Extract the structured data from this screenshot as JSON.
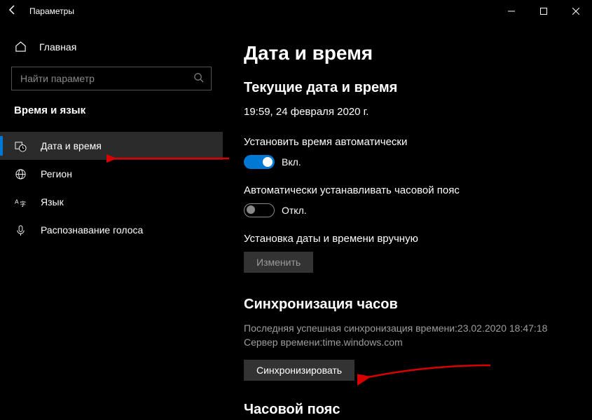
{
  "titlebar": {
    "title": "Параметры"
  },
  "sidebar": {
    "home_label": "Главная",
    "search_placeholder": "Найти параметр",
    "category_label": "Время и язык",
    "items": [
      {
        "label": "Дата и время"
      },
      {
        "label": "Регион"
      },
      {
        "label": "Язык"
      },
      {
        "label": "Распознавание голоса"
      }
    ]
  },
  "main": {
    "page_title": "Дата и время",
    "current_heading": "Текущие дата и время",
    "current_value": "19:59, 24 февраля 2020 г.",
    "auto_time_label": "Установить время автоматически",
    "auto_time_state": "Вкл.",
    "auto_tz_label": "Автоматически устанавливать часовой пояс",
    "auto_tz_state": "Откл.",
    "manual_label": "Установка даты и времени вручную",
    "change_button": "Изменить",
    "sync_heading": "Синхронизация часов",
    "sync_last": "Последняя успешная синхронизация времени:23.02.2020 18:47:18",
    "sync_server": "Сервер времени:time.windows.com",
    "sync_button": "Синхронизировать",
    "tz_heading": "Часовой пояс"
  }
}
